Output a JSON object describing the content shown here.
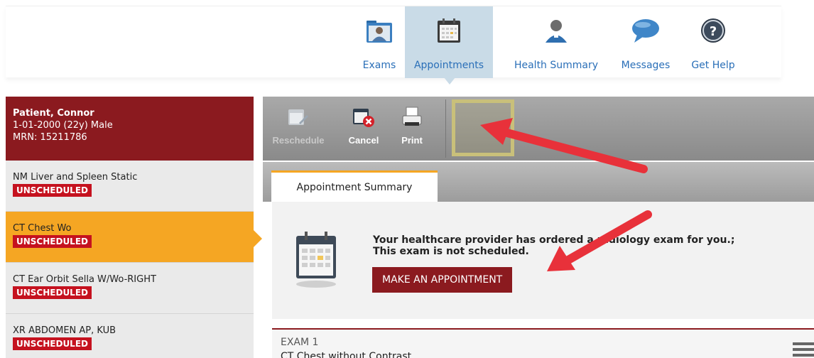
{
  "nav": {
    "items": [
      {
        "label": "Exams",
        "icon": "folder-patient-icon"
      },
      {
        "label": "Appointments",
        "icon": "calendar-icon",
        "active": true
      },
      {
        "label": "Health Summary",
        "icon": "person-icon"
      },
      {
        "label": "Messages",
        "icon": "speech-bubble-icon"
      },
      {
        "label": "Get Help",
        "icon": "help-icon"
      }
    ]
  },
  "patient": {
    "name": "Patient, Connor",
    "dob_line": "1-01-2000 (22y) Male",
    "mrn_line": "MRN: 15211786"
  },
  "exams": [
    {
      "title": "NM Liver and Spleen Static",
      "status": "UNSCHEDULED"
    },
    {
      "title": "CT Chest Wo",
      "status": "UNSCHEDULED",
      "selected": true
    },
    {
      "title": "CT Ear Orbit Sella W/Wo-RIGHT",
      "status": "UNSCHEDULED"
    },
    {
      "title": "XR ABDOMEN AP, KUB",
      "status": "UNSCHEDULED"
    }
  ],
  "toolbar": {
    "reschedule_label": "Reschedule",
    "cancel_label": "Cancel",
    "print_label": "Print"
  },
  "tabs": {
    "summary_label": "Appointment Summary"
  },
  "summary": {
    "line1": "Your healthcare provider has ordered a radiology exam for you.;",
    "line2": "This exam is not scheduled.",
    "button_label": "MAKE AN APPOINTMENT"
  },
  "exam_detail": {
    "label": "EXAM 1",
    "value": "CT Chest without Contrast"
  },
  "colors": {
    "brand_maroon": "#8b1a1f",
    "selected_orange": "#f5a623",
    "badge_red": "#c5121f",
    "nav_link_blue": "#2a6fb8",
    "arrow_red": "#e8313a"
  }
}
